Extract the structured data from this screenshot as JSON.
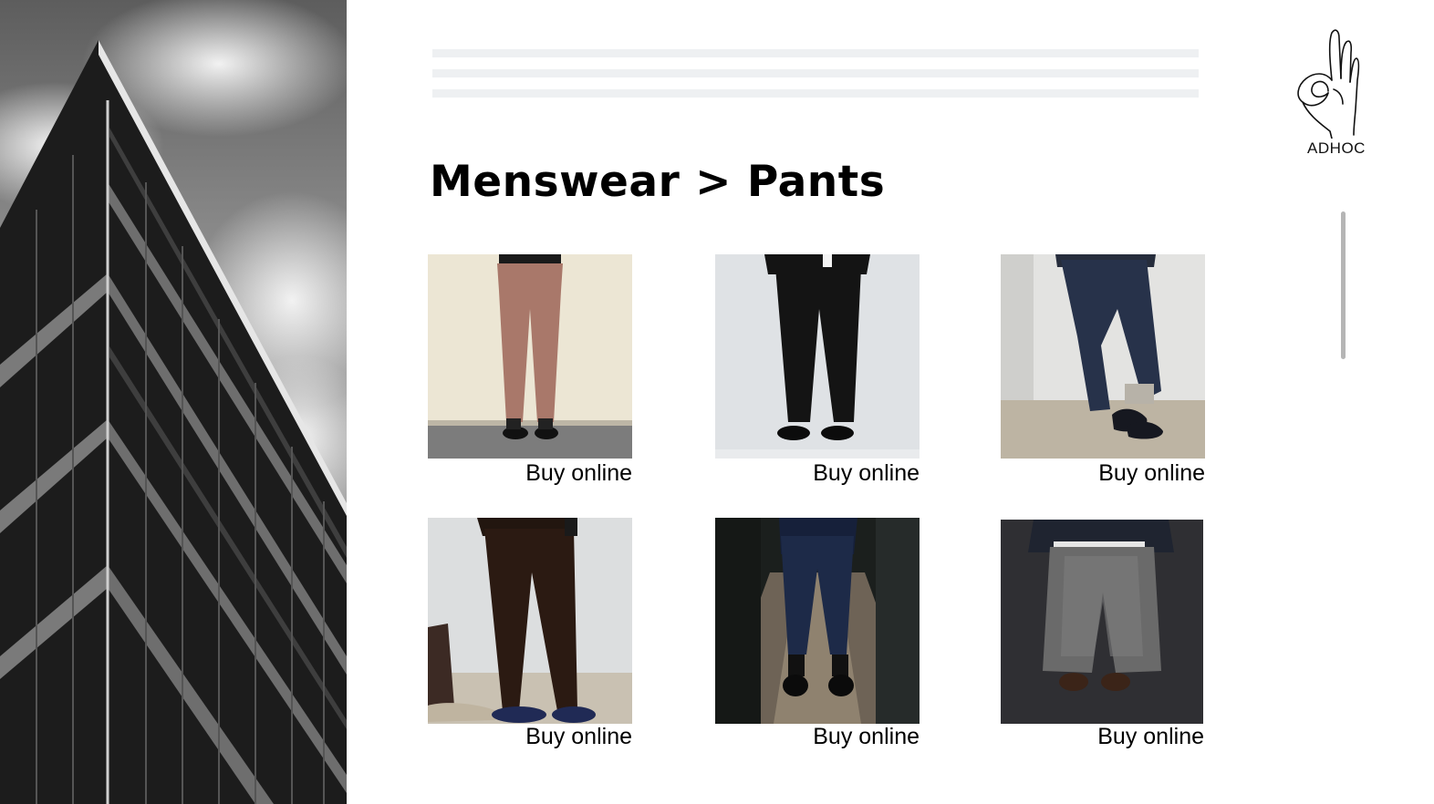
{
  "brand": {
    "logo_text": "ADHOC"
  },
  "page": {
    "title": "Menswear > Pants"
  },
  "products": [
    {
      "cta": "Buy online"
    },
    {
      "cta": "Buy online"
    },
    {
      "cta": "Buy online"
    },
    {
      "cta": "Buy online"
    },
    {
      "cta": "Buy online"
    },
    {
      "cta": "Buy online"
    }
  ],
  "icons": {
    "menu": "hamburger-menu-icon",
    "logo": "ok-hand-icon"
  },
  "colors": {
    "menu_lines": "#eef0f2",
    "scrollbar": "#b5b5b5",
    "text": "#000000"
  }
}
